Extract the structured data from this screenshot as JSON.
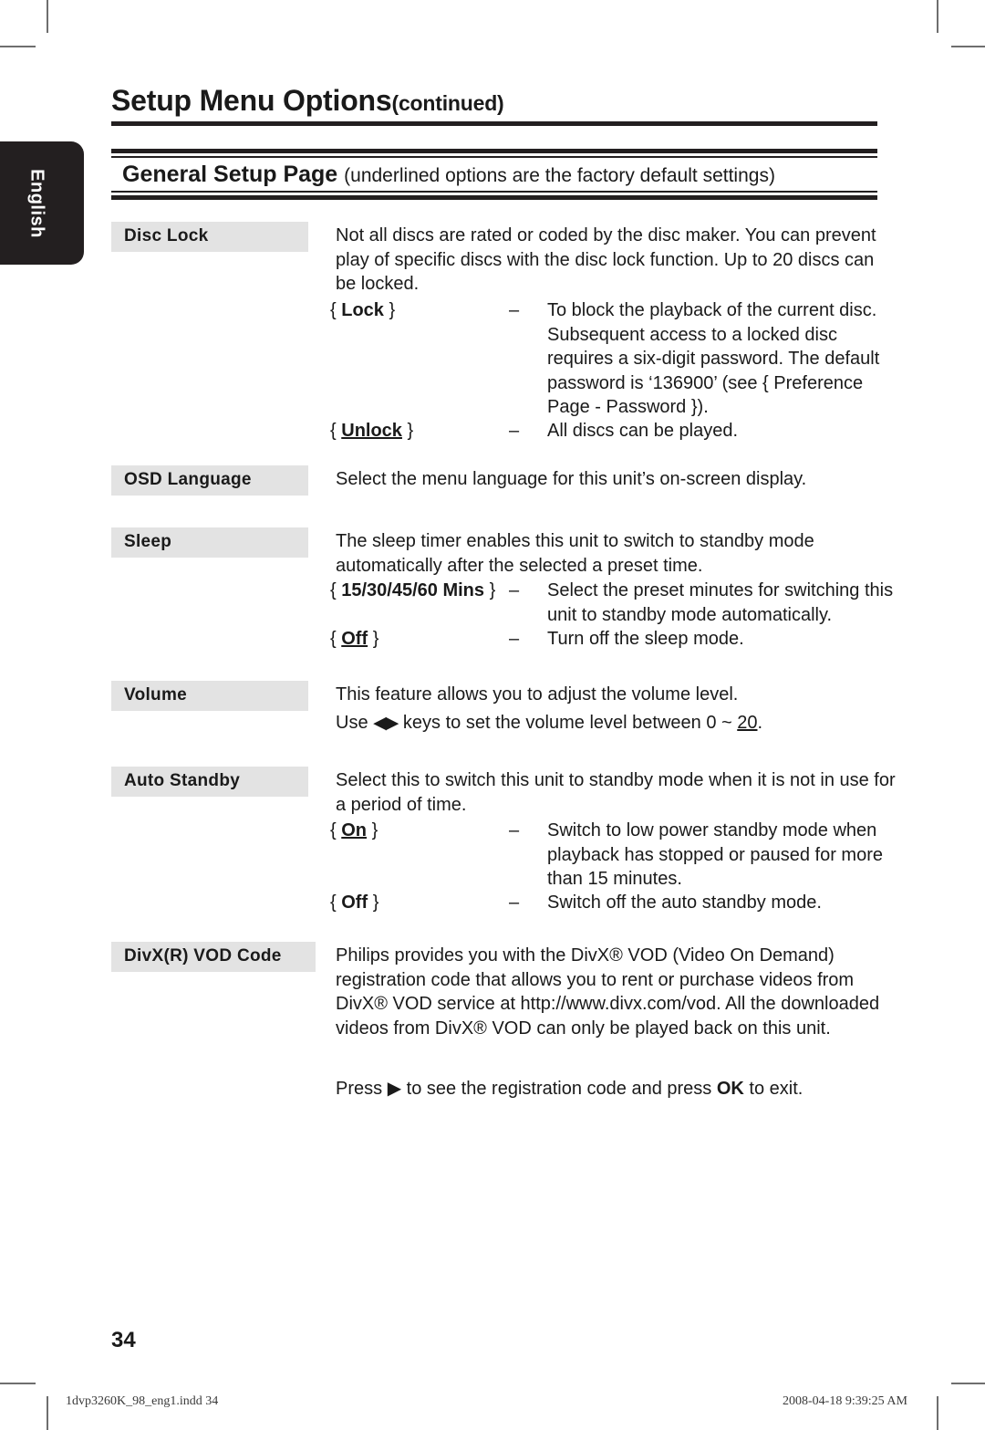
{
  "document": {
    "title": "Setup Menu Options",
    "title_continued": "(continued)",
    "language_tab": "English",
    "section_heading": "General Setup Page",
    "section_heading_note": "(underlined options are the factory default settings)",
    "page_number": "34",
    "footer_file": "1dvp3260K_98_eng1.indd   34",
    "footer_timestamp": "2008-04-18   9:39:25 AM"
  },
  "entries": {
    "disc_lock": {
      "label": "Disc Lock",
      "intro": "Not all discs are rated or coded by the disc maker. You can prevent play of specific discs with the disc lock function. Up to 20 discs can be locked.",
      "option_lock_key_open": "{ ",
      "option_lock_key": "Lock",
      "option_lock_key_close": " }",
      "option_lock_dash": "–",
      "option_lock_desc": "To block the playback of the current disc. Subsequent access to a locked disc requires a six-digit password. The default password is ‘136900’ (see { Preference Page - Password }).",
      "option_unlock_key_open": "{ ",
      "option_unlock_key": "Unlock",
      "option_unlock_key_close": " }",
      "option_unlock_dash": "–",
      "option_unlock_desc": "All discs can be played."
    },
    "osd_language": {
      "label": "OSD Language",
      "intro": "Select the menu language for this unit’s on-screen display."
    },
    "sleep": {
      "label": "Sleep",
      "intro": "The sleep timer enables this unit to switch to standby mode automatically after the selected a preset time.",
      "option_mins_key_open": "{ ",
      "option_mins_key": "15/30/45/60 Mins",
      "option_mins_key_close": " }",
      "option_mins_dash": "–",
      "option_mins_desc": "Select the preset minutes for switching this unit to standby mode automatically.",
      "option_off_key_open": "{ ",
      "option_off_key": "Off",
      "option_off_key_close": " }",
      "option_off_dash": "–",
      "option_off_desc": "Turn off the sleep mode."
    },
    "volume": {
      "label": "Volume",
      "intro": "This feature allows you to adjust the volume level.",
      "line_use": "Use ",
      "keys_icon": "◀▶",
      "line_rest_pre": " keys to set the volume level between 0 ~ ",
      "line_default": "20",
      "line_rest_post": "."
    },
    "auto_standby": {
      "label": "Auto Standby",
      "intro": "Select this to switch this unit to standby mode when it is not in use for a period of time.",
      "option_on_key_open": "{ ",
      "option_on_key": "On",
      "option_on_key_close": " }",
      "option_on_dash": "–",
      "option_on_desc": "Switch to low power standby mode when playback has stopped or paused for more than 15 minutes.",
      "option_off_key_open": "{ ",
      "option_off_key": "Off",
      "option_off_key_close": " }",
      "option_off_dash": "–",
      "option_off_desc": "Switch off the auto standby mode."
    },
    "divx_vod": {
      "label": "DivX(R) VOD Code",
      "intro": "Philips provides you with the DivX® VOD (Video On Demand) registration code that allows you to rent or purchase videos from DivX® VOD service at http://www.divx.com/vod. All the downloaded videos from DivX® VOD can only be played back on this unit.",
      "press_pre": "Press ",
      "press_icon": "▶",
      "press_mid": " to see the registration code and press ",
      "press_ok": "OK",
      "press_post": " to exit."
    }
  }
}
